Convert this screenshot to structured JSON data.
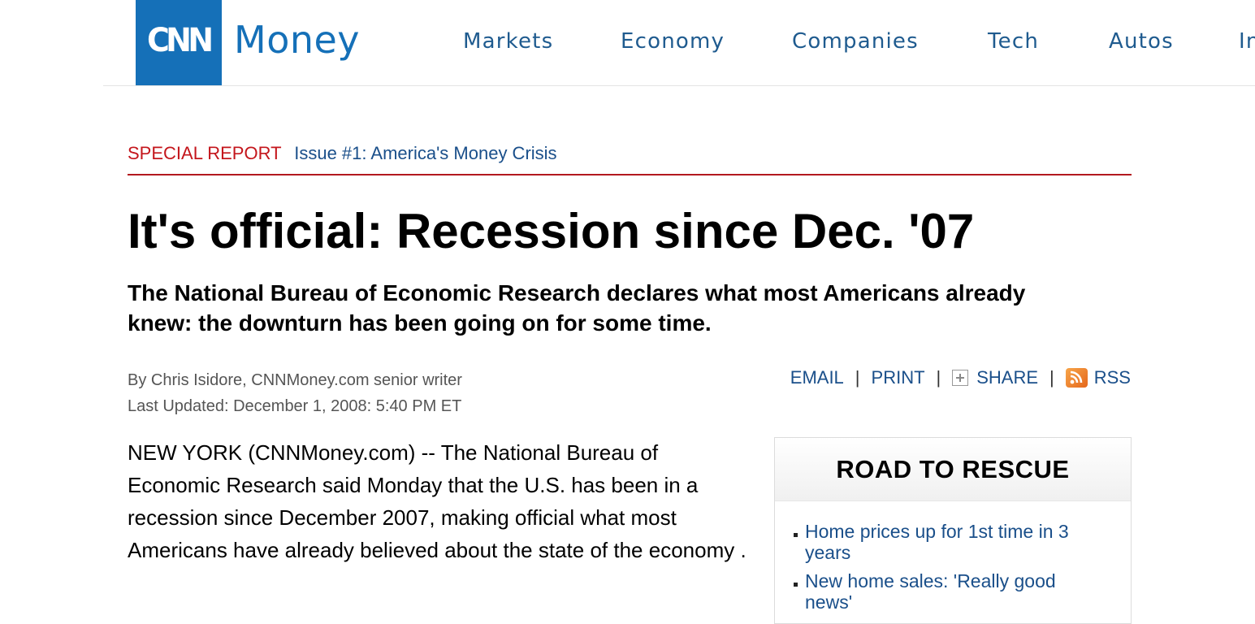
{
  "header": {
    "logo": "CNN",
    "brand": "Money",
    "nav": [
      "Markets",
      "Economy",
      "Companies",
      "Tech",
      "Autos",
      "In"
    ]
  },
  "article": {
    "section_label": "SPECIAL REPORT",
    "section_link": "Issue #1: America's Money Crisis",
    "headline": "It's official: Recession since Dec. '07",
    "deck": "The National Bureau of Economic Research declares what most Americans already knew: the downturn has been going on for some time.",
    "byline": "By Chris Isidore, CNNMoney.com senior writer",
    "updated": "Last Updated: December 1, 2008: 5:40 PM ET",
    "body_first_paragraph": "NEW YORK (CNNMoney.com) -- The National Bureau of Economic Research said Monday that the U.S. has been in a recession since December 2007, making official what most Americans have already believed about the state of the economy ."
  },
  "tools": {
    "email": "EMAIL",
    "print": "PRINT",
    "share": "SHARE",
    "rss": "RSS",
    "separator": "|"
  },
  "sidebar": {
    "title": "ROAD TO RESCUE",
    "items": [
      "Home prices up for 1st time in 3 years",
      "New home sales: 'Really good news'"
    ]
  },
  "colors": {
    "brand_blue": "#1570b8",
    "link_blue": "#1a4f8a",
    "special_red": "#c4161c"
  }
}
